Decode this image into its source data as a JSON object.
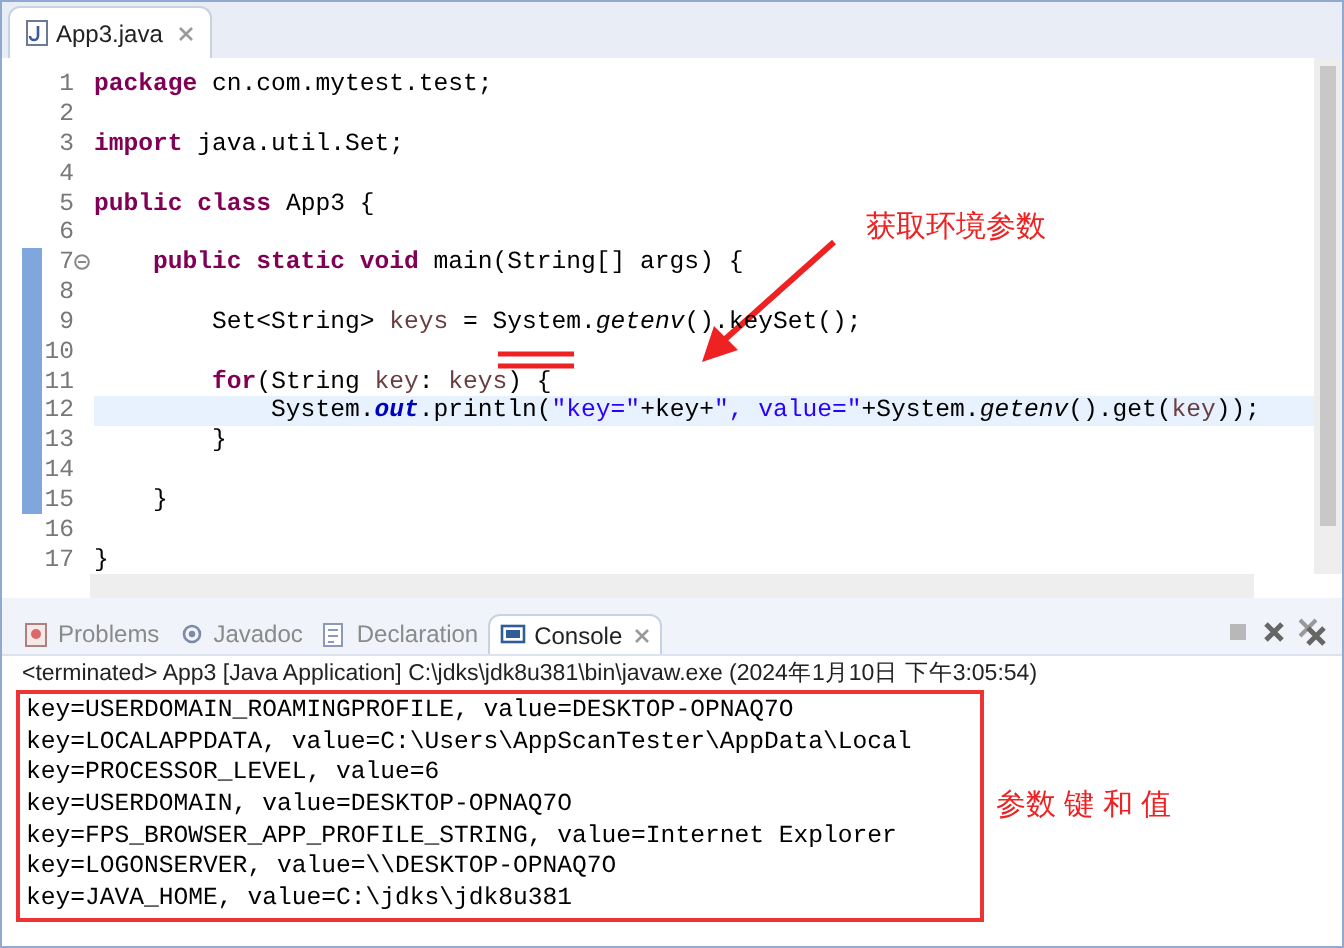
{
  "editor": {
    "tab": {
      "title": "App3.java",
      "selected": true
    },
    "lines": [
      {
        "number": "1",
        "changed": false,
        "current": false,
        "tokens": [
          {
            "kind": "keyword",
            "text": "package"
          },
          {
            "kind": "plain",
            "text": " cn.com.mytest.test;"
          }
        ]
      },
      {
        "number": "2",
        "changed": false,
        "current": false
      },
      {
        "number": "3",
        "changed": false,
        "current": false,
        "tokens": [
          {
            "kind": "keyword",
            "text": "import"
          },
          {
            "kind": "plain",
            "text": " java.util.Set;"
          }
        ]
      },
      {
        "number": "4",
        "changed": false,
        "current": false
      },
      {
        "number": "5",
        "changed": false,
        "current": false,
        "tokens": [
          {
            "kind": "keyword",
            "text": "public class"
          },
          {
            "kind": "plain",
            "text": " App3 {"
          }
        ]
      },
      {
        "number": "6",
        "changed": false,
        "current": false
      },
      {
        "number": "7",
        "changed": true,
        "current": false,
        "expanded": true,
        "tokens": [
          {
            "kind": "keyword",
            "text": "    public static void"
          },
          {
            "kind": "plain",
            "text": " main(String[] args) {"
          }
        ]
      },
      {
        "number": "8",
        "changed": true,
        "current": false
      },
      {
        "number": "9",
        "changed": true,
        "current": false,
        "tokens": [
          {
            "kind": "plain",
            "text": "        Set<String> "
          },
          {
            "kind": "variable",
            "text": "keys"
          },
          {
            "kind": "plain",
            "text": " = System."
          },
          {
            "kind": "static_method",
            "text": "getenv"
          },
          {
            "kind": "plain",
            "text": "().keySet();"
          }
        ]
      },
      {
        "number": "10",
        "changed": true,
        "current": false
      },
      {
        "number": "11",
        "changed": true,
        "current": false,
        "tokens": [
          {
            "kind": "keyword",
            "text": "        for"
          },
          {
            "kind": "plain",
            "text": "(String "
          },
          {
            "kind": "variable",
            "text": "key"
          },
          {
            "kind": "plain",
            "text": ": "
          },
          {
            "kind": "variable",
            "text": "keys"
          },
          {
            "kind": "plain",
            "text": ") {"
          }
        ]
      },
      {
        "number": "12",
        "changed": true,
        "current": true,
        "tokens": [
          {
            "kind": "plain",
            "text": "            System."
          },
          {
            "kind": "static_field",
            "text": "out"
          },
          {
            "kind": "plain",
            "text": ".println("
          },
          {
            "kind": "string",
            "text": "\"key=\""
          },
          {
            "kind": "plain",
            "text": "+key+"
          },
          {
            "kind": "string",
            "text": "\", value=\""
          },
          {
            "kind": "plain",
            "text": "+System."
          },
          {
            "kind": "static_method",
            "text": "getenv"
          },
          {
            "kind": "plain",
            "text": "().get("
          },
          {
            "kind": "variable",
            "text": "key"
          },
          {
            "kind": "plain",
            "text": "));"
          }
        ]
      },
      {
        "number": "13",
        "changed": true,
        "current": false,
        "tokens": [
          {
            "kind": "plain",
            "text": "        }"
          }
        ]
      },
      {
        "number": "14",
        "changed": true,
        "current": false
      },
      {
        "number": "15",
        "changed": true,
        "current": false,
        "tokens": [
          {
            "kind": "plain",
            "text": "    }"
          }
        ]
      },
      {
        "number": "16",
        "changed": false,
        "current": false
      },
      {
        "number": "17",
        "changed": false,
        "current": false,
        "tokens": [
          {
            "kind": "plain",
            "text": "}"
          }
        ]
      }
    ],
    "annotation": "获取环境参数"
  },
  "console_view": {
    "tabs": [
      {
        "label": "Problems",
        "kind": "problems",
        "selected": false
      },
      {
        "label": "Javadoc",
        "kind": "javadoc",
        "selected": false
      },
      {
        "label": "Declaration",
        "kind": "declaration",
        "selected": false
      },
      {
        "label": "Console",
        "kind": "console",
        "selected": true
      }
    ],
    "status": "<terminated> App3 [Java Application] C:\\jdks\\jdk8u381\\bin\\javaw.exe (2024年1月10日 下午3:05:54)",
    "output": [
      "key=USERDOMAIN_ROAMINGPROFILE, value=DESKTOP-OPNAQ7O",
      "key=LOCALAPPDATA, value=C:\\Users\\AppScanTester\\AppData\\Local",
      "key=PROCESSOR_LEVEL, value=6",
      "key=USERDOMAIN, value=DESKTOP-OPNAQ7O",
      "key=FPS_BROWSER_APP_PROFILE_STRING, value=Internet Explorer",
      "key=LOGONSERVER, value=\\\\DESKTOP-OPNAQ7O",
      "key=JAVA_HOME, value=C:\\jdks\\jdk8u381"
    ],
    "annotation": "参数 键 和 值"
  }
}
